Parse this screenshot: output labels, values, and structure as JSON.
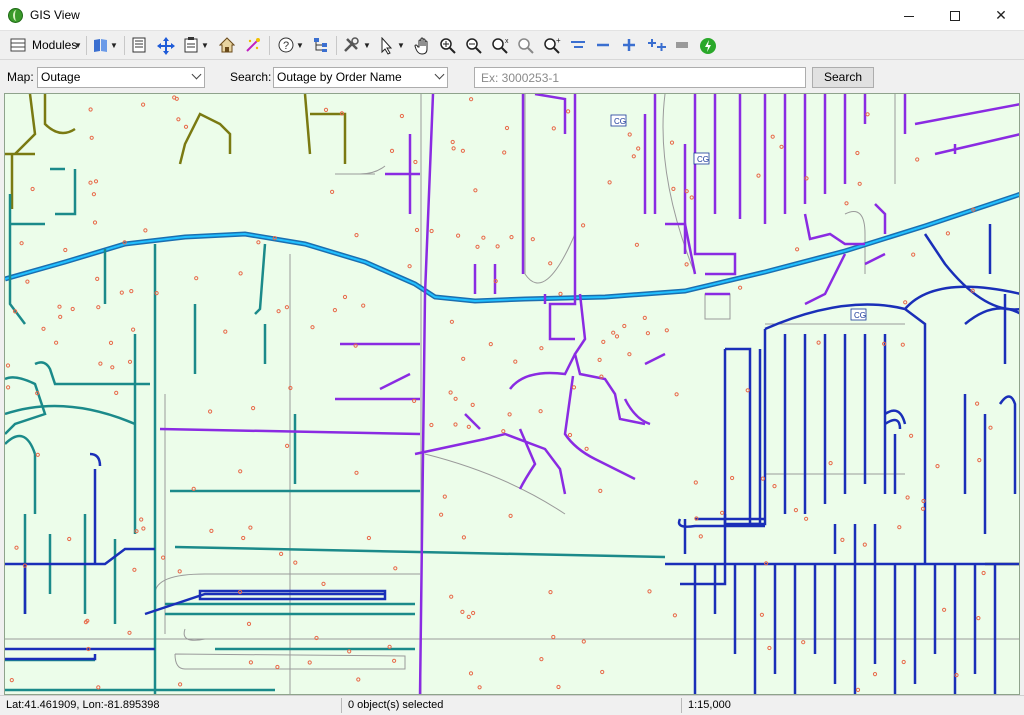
{
  "window": {
    "title": "GIS View"
  },
  "toolbar": {
    "modules_label": "Modules",
    "tools": [
      "modules-icon",
      "book-icon",
      "list-icon",
      "move-icon",
      "clipboard-icon",
      "home-icon",
      "sparkle-icon",
      "help-icon",
      "tree-icon",
      "tools-icon",
      "pointer-icon",
      "pan-hand-icon",
      "zoom-in-icon",
      "zoom-out-icon",
      "zoom-extent-icon",
      "zoom-previous-icon",
      "zoom-next-icon",
      "shrink-icon",
      "minus-icon",
      "plus-icon",
      "expand-icon",
      "layer-icon",
      "refresh-icon"
    ]
  },
  "search_bar": {
    "map_label": "Map:",
    "map_value": "Outage",
    "search_label": "Search:",
    "search_value": "Outage by Order Name",
    "query_placeholder": "Ex: 3000253-1",
    "search_button": "Search"
  },
  "map": {
    "labels": [
      "CG",
      "CG",
      "CG"
    ],
    "colors": {
      "background": "#ecfdea",
      "primary_feeder": "#1a9ad6",
      "purple_lines": "#8a2be2",
      "blue_lines": "#1a2fb8",
      "teal_lines": "#1b8a8a",
      "olive_lines": "#7a7a12",
      "gray_lines": "#9a9a9a",
      "poles": "#e86a4a"
    }
  },
  "status": {
    "coordinates": "Lat:41.461909, Lon:-81.895398",
    "selection": "0 object(s) selected",
    "scale": "1:15,000"
  }
}
